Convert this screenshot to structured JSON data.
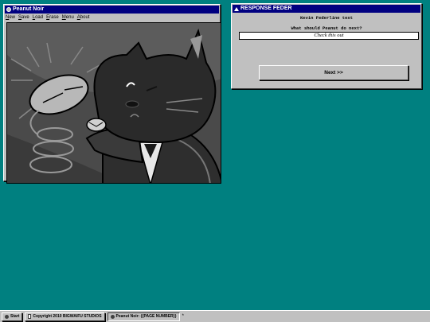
{
  "peanut_window": {
    "title": "Peanut Noir",
    "menu": [
      "New",
      "Save",
      "Load",
      "Erase",
      "Menu",
      "About"
    ]
  },
  "response_window": {
    "title": "RESPONSE FEDER",
    "header_text": "Kevin Federline text",
    "prompt": "What should Peanut do next?",
    "input_value": "Check this out",
    "next_label": "Next >>"
  },
  "taskbar": {
    "start_label": "Start",
    "copyright_label": "Copyright 2010 BIGWAIFU STUDIOS",
    "task_label": "Peanut Noir: {{PAGE NUMBER}}",
    "overflow": "*"
  },
  "colors": {
    "desktop": "#008080",
    "titlebar": "#000080",
    "window_face": "#c0c0c0"
  }
}
